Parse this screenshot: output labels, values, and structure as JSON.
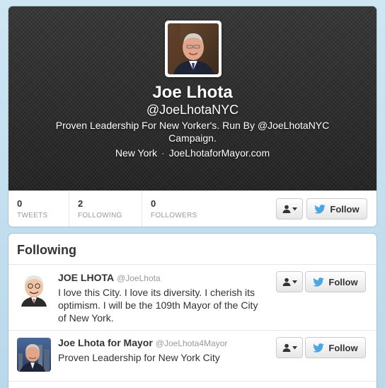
{
  "profile": {
    "name": "Joe Lhota",
    "handle": "@JoeLhotaNYC",
    "bio": "Proven Leadership For New Yorker's. Run By @JoeLhotaNYC Campaign.",
    "location": "New York",
    "separator": "·",
    "url": "JoeLhotaforMayor.com",
    "avatar_icon": "profile-photo"
  },
  "stats": [
    {
      "value": "0",
      "label": "TWEETS"
    },
    {
      "value": "2",
      "label": "FOLLOWING"
    },
    {
      "value": "0",
      "label": "FOLLOWERS"
    }
  ],
  "follow_label": "Follow",
  "following_panel": {
    "title": "Following",
    "users": [
      {
        "fullname": "JOE LHOTA",
        "screenname": "@JoeLhota",
        "bio": "I love this City. I love its diversity. I cherish its optimism. I will be the 109th Mayor of the City of New York.",
        "follow_label": "Follow"
      },
      {
        "fullname": "Joe Lhota for Mayor",
        "screenname": "@JoeLhota4Mayor",
        "bio": "Proven Leadership for New York City",
        "follow_label": "Follow"
      }
    ]
  },
  "colors": {
    "page_bg": "#c0deed",
    "header_bg": "#2d2d2d",
    "twitter_blue": "#4ba6e2"
  }
}
